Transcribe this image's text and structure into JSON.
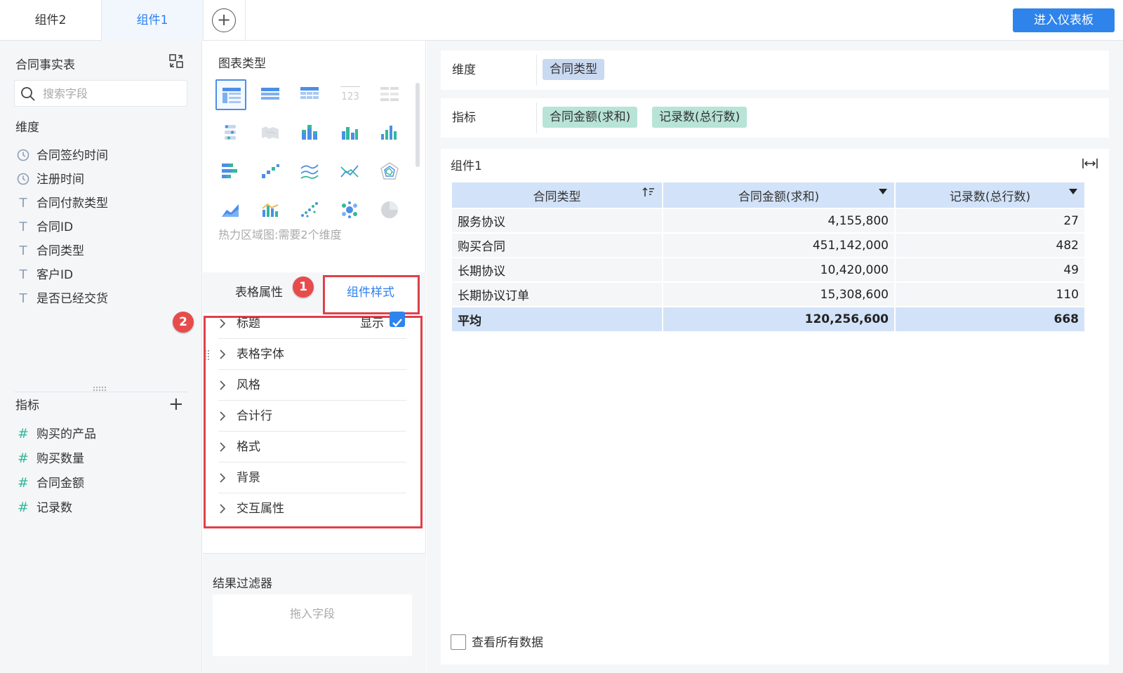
{
  "tabs": [
    {
      "label": "组件2"
    },
    {
      "label": "组件1"
    }
  ],
  "enter_dashboard_label": "进入仪表板",
  "left": {
    "table_title": "合同事实表",
    "search_placeholder": "搜索字段",
    "dimension_label": "维度",
    "dimensions": [
      {
        "name": "合同签约时间",
        "icon": "clock-icon"
      },
      {
        "name": "注册时间",
        "icon": "clock-icon"
      },
      {
        "name": "合同付款类型",
        "icon": "text-type-icon"
      },
      {
        "name": "合同ID",
        "icon": "text-type-icon"
      },
      {
        "name": "合同类型",
        "icon": "text-type-icon"
      },
      {
        "name": "客户ID",
        "icon": "text-type-icon"
      },
      {
        "name": "是否已经交货",
        "icon": "text-type-icon"
      }
    ],
    "metric_label": "指标",
    "metrics": [
      {
        "name": "购买的产品",
        "icon": "hash-icon"
      },
      {
        "name": "购买数量",
        "icon": "hash-icon"
      },
      {
        "name": "合同金额",
        "icon": "hash-icon"
      },
      {
        "name": "记录数",
        "icon": "hash-icon"
      }
    ]
  },
  "middle": {
    "chart_type_title": "图表类型",
    "heat_hint": "热力区域图:需要2个维度",
    "style_tabs": {
      "table_props": "表格属性",
      "component_style": "组件样式"
    },
    "badge1": "1",
    "badge2": "2",
    "accordion": [
      {
        "label": "标题"
      },
      {
        "label": "表格字体"
      },
      {
        "label": "风格"
      },
      {
        "label": "合计行"
      },
      {
        "label": "格式"
      },
      {
        "label": "背景"
      },
      {
        "label": "交互属性"
      }
    ],
    "show_label": "显示",
    "show_checked": true,
    "result_filter_title": "结果过滤器",
    "drop_hint": "拖入字段"
  },
  "right": {
    "dimension_label": "维度",
    "dimension_pills": [
      "合同类型"
    ],
    "metric_label": "指标",
    "metric_pills": [
      "合同金额(求和)",
      "记录数(总行数)"
    ],
    "card_title": "组件1",
    "table": {
      "headers": [
        "合同类型",
        "合同金额(求和)",
        "记录数(总行数)"
      ],
      "rows": [
        [
          "服务协议",
          "4,155,800",
          "27"
        ],
        [
          "购买合同",
          "451,142,000",
          "482"
        ],
        [
          "长期协议",
          "10,420,000",
          "49"
        ],
        [
          "长期协议订单",
          "15,308,600",
          "110"
        ]
      ],
      "avg_row": [
        "平均",
        "120,256,600",
        "668"
      ]
    },
    "view_all_label": "查看所有数据"
  },
  "colors": {
    "accent": "#2f84ec",
    "highlight_red": "#e0404a",
    "pill_blue": "#c9d9f2",
    "pill_green": "#b7e4d7",
    "header_blue": "#d2e2f8"
  }
}
